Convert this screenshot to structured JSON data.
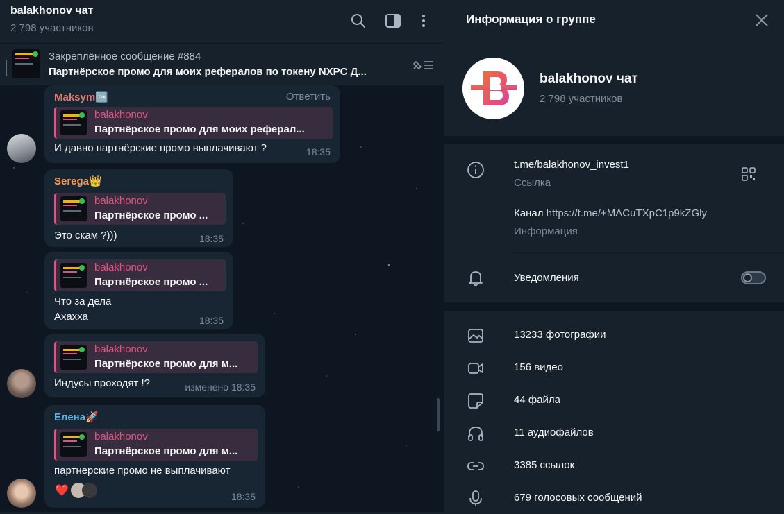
{
  "chat": {
    "title": "balakhonov чат",
    "subtitle": "2 798 участников",
    "pinned": {
      "label": "Закреплённое сообщение #884",
      "text": "Партнёрское промо для моих рефералов по токену NXPC  Д..."
    },
    "messages": [
      {
        "sender": "Maksym",
        "sender_emoji": "🆒",
        "sender_color": "#e27a71",
        "reply_action": "Ответить",
        "quote_name": "balakhonov",
        "quote_text": "Партнёрское промо для моих реферал...",
        "text": "И давно партнёрские промо выплачивают ?",
        "time": "18:35"
      },
      {
        "sender": "Serega",
        "sender_emoji": "👑",
        "sender_color": "#f29c57",
        "quote_name": "balakhonov",
        "quote_text": "Партнёрское промо ...",
        "text": "Это скам ?)))",
        "time": "18:35"
      },
      {
        "quote_name": "balakhonov",
        "quote_text": "Партнёрское промо ...",
        "text_line1": "Что за дела",
        "text_line2": "Ахахха",
        "time": "18:35"
      },
      {
        "quote_name": "balakhonov",
        "quote_text": "Партнёрское промо для м...",
        "text": "Индусы  проходят !?",
        "time": "изменено 18:35"
      },
      {
        "sender": "Елена",
        "sender_emoji": "🚀",
        "sender_color": "#5fb4e4",
        "quote_name": "balakhonov",
        "quote_text": "Партнёрское промо для м...",
        "text": "партнерские промо не выплачивают",
        "reaction": "❤️",
        "time": "18:35"
      }
    ]
  },
  "info": {
    "title": "Информация о группе",
    "group_name": "balakhonov чат",
    "group_count": "2 798 участников",
    "link": "t.me/balakhonov_invest1",
    "link_label": "Ссылка",
    "description_prefix": "Канал",
    "description_link": "https://t.me/+MACuTXpC1p9kZGly",
    "description_label": "Информация",
    "notifications_label": "Уведомления",
    "notifications_on": false,
    "media": [
      {
        "icon": "photo-icon",
        "label": "13233 фотографии"
      },
      {
        "icon": "video-icon",
        "label": "156 видео"
      },
      {
        "icon": "file-icon",
        "label": "44 файла"
      },
      {
        "icon": "headphones-icon",
        "label": "11 аудиофайлов"
      },
      {
        "icon": "link-icon",
        "label": "3385 ссылок"
      },
      {
        "icon": "microphone-icon",
        "label": "679 голосовых сообщений"
      }
    ]
  },
  "colors": {
    "background": "#0e1621",
    "panel": "#17212b",
    "bubble": "#182533",
    "accent_quote": "#e15482",
    "muted": "#7d8b99"
  }
}
